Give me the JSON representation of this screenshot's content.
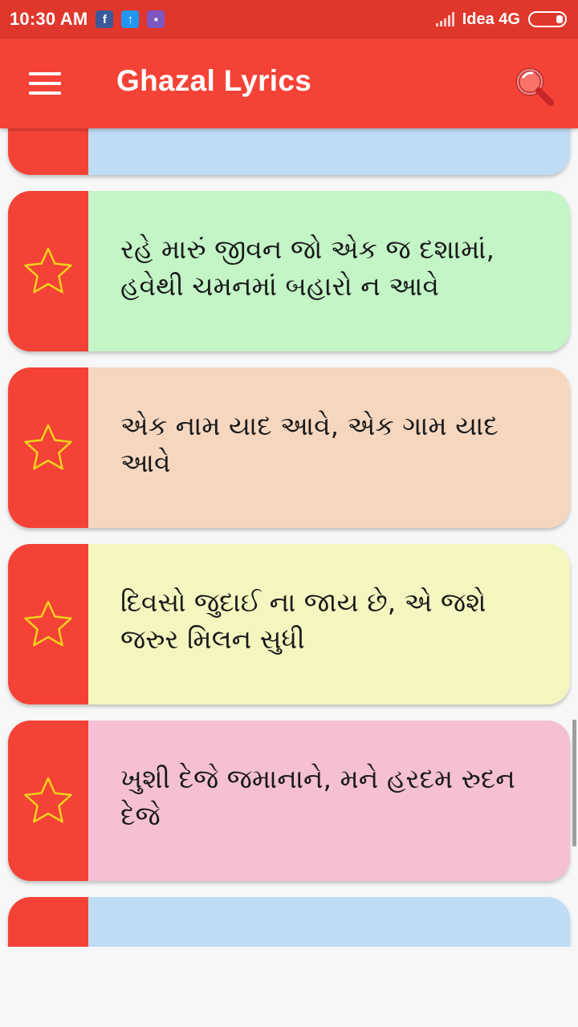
{
  "status_bar": {
    "time": "10:30 AM",
    "carrier": "Idea 4G",
    "notification_icons": [
      "facebook-icon",
      "upload-icon",
      "app-notification-icon"
    ]
  },
  "app_bar": {
    "title": "Ghazal Lyrics"
  },
  "colors": {
    "status_bar": "#e0372c",
    "app_bar": "#f44336",
    "star_stroke": "#f2d21b"
  },
  "cards": [
    {
      "text": "",
      "color": "#bfdcf5"
    },
    {
      "text": "રહે મારું જીવન જો એક જ દશામાં, હવેથી ચમનમાં બહારો ન આવે",
      "color": "#c3f5c6"
    },
    {
      "text": "એક નામ યાદ આવે, એક ગામ યાદ આવે",
      "color": "#f5d7c0"
    },
    {
      "text": "દિવસો જુદાઈ ના જાય છે, એ જશે જરુર મિલન સુધી",
      "color": "#f5f5c0"
    },
    {
      "text": "ખુશી દેજે જમાનાને, મને હરદમ રુદન દેજે",
      "color": "#f5c0d3"
    },
    {
      "text": "",
      "color": "#bfdcf5"
    }
  ]
}
